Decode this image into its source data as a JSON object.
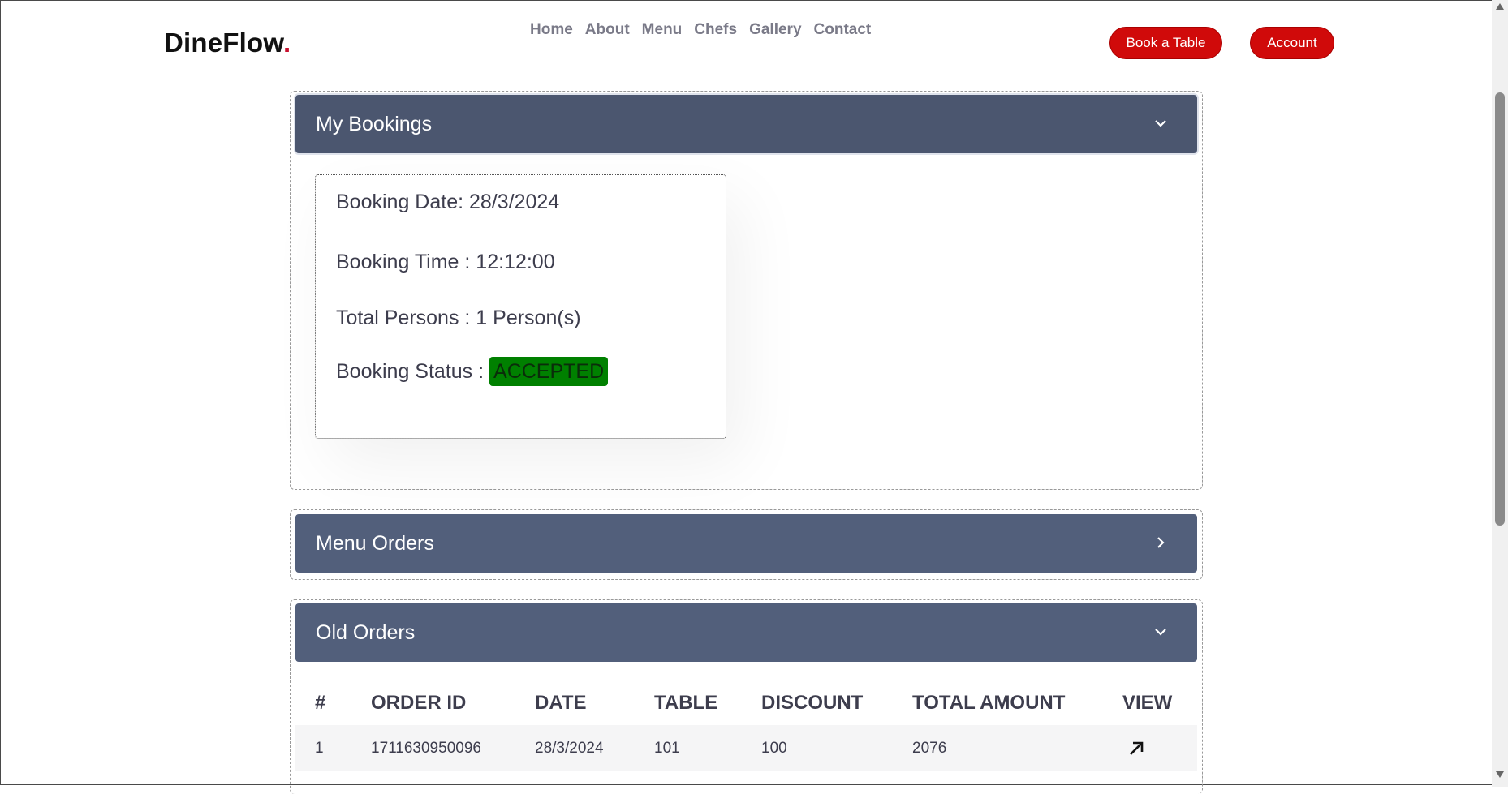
{
  "brand": {
    "name": "DineFlow",
    "dot": "."
  },
  "nav": {
    "items": [
      "Home",
      "About",
      "Menu",
      "Chefs",
      "Gallery",
      "Contact"
    ]
  },
  "header_buttons": {
    "book_table": "Book a Table",
    "account": "Account"
  },
  "sections": {
    "bookings": {
      "title": "My Bookings",
      "expanded": true
    },
    "menu_orders": {
      "title": "Menu Orders",
      "expanded": false
    },
    "old_orders": {
      "title": "Old Orders",
      "expanded": true
    }
  },
  "booking_card": {
    "date": "Booking Date: 28/3/2024",
    "time": "Booking Time : 12:12:00",
    "persons": "Total Persons : 1 Person(s)",
    "status_label": "Booking Status : ",
    "status_value": "ACCEPTED"
  },
  "orders_table": {
    "columns": [
      "#",
      "ORDER ID",
      "DATE",
      "TABLE",
      "DISCOUNT",
      "TOTAL AMOUNT",
      "VIEW"
    ],
    "rows": [
      {
        "num": "1",
        "order_id": "1711630950096",
        "date": "28/3/2024",
        "table": "101",
        "discount": "100",
        "total": "2076",
        "view_icon": "arrow-up-right-icon"
      }
    ]
  },
  "colors": {
    "accent": "#d00a0a",
    "section_header": "#525f7b",
    "status_accepted": "#008000"
  }
}
